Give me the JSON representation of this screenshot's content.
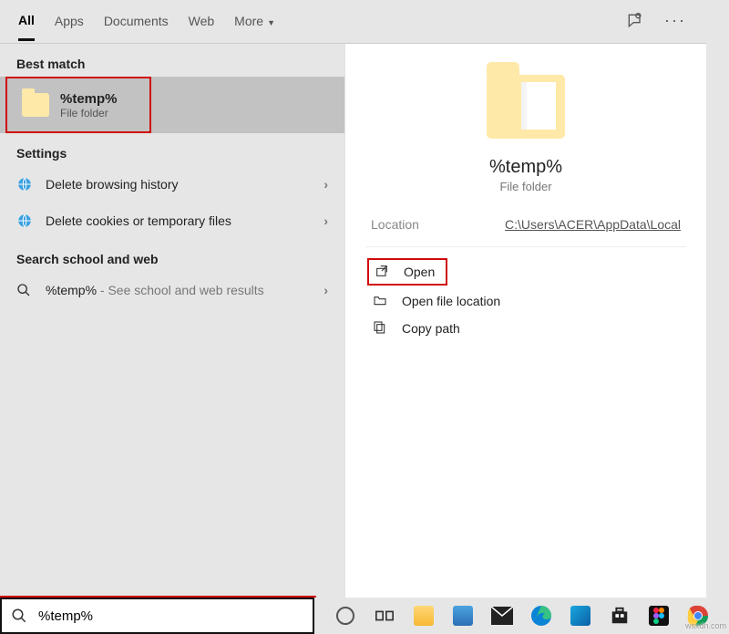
{
  "tabs": {
    "all": "All",
    "apps": "Apps",
    "documents": "Documents",
    "web": "Web",
    "more": "More"
  },
  "header_icons": {
    "feedback": "feedback-icon",
    "more": "more-icon"
  },
  "sections": {
    "best_match": "Best match",
    "settings": "Settings",
    "search_web": "Search school and web"
  },
  "best_match_item": {
    "title": "%temp%",
    "subtitle": "File folder"
  },
  "settings_items": [
    {
      "icon": "globe-icon",
      "label": "Delete browsing history"
    },
    {
      "icon": "globe-icon",
      "label": "Delete cookies or temporary files"
    }
  ],
  "web_item": {
    "icon": "search-icon",
    "term": "%temp%",
    "suffix": " - See school and web results"
  },
  "preview": {
    "title": "%temp%",
    "subtitle": "File folder",
    "location_label": "Location",
    "location_value": "C:\\Users\\ACER\\AppData\\Local",
    "actions": {
      "open": "Open",
      "open_location": "Open file location",
      "copy_path": "Copy path"
    }
  },
  "search_input": {
    "value": "%temp%"
  },
  "taskbar": {
    "items": [
      "cortana-icon",
      "task-view-icon",
      "file-explorer-icon",
      "notepad-icon",
      "mail-icon",
      "edge-icon",
      "photos-icon",
      "store-icon",
      "figma-icon",
      "chrome-icon"
    ]
  },
  "watermark": "wsxdn.com"
}
